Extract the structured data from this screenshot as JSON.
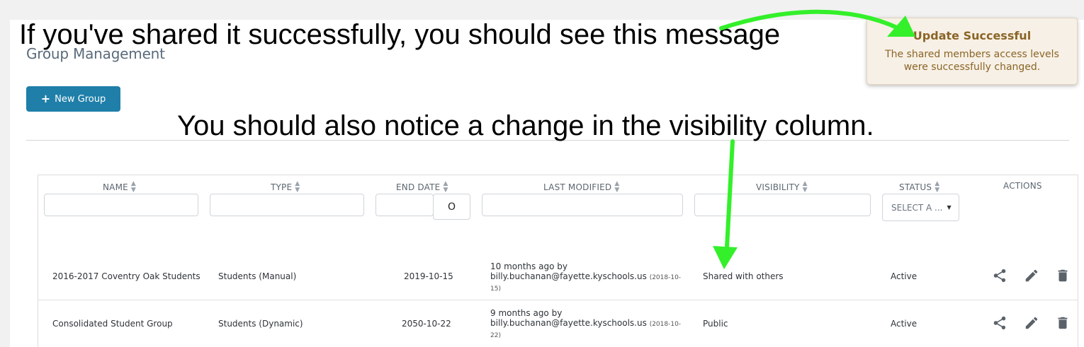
{
  "annotations": {
    "top_caption": "If you've shared it successfully, you should see this message",
    "mid_caption": "You should also notice a change in the visibility column.",
    "arrow_color": "#33f02a"
  },
  "page": {
    "title": "Group Management",
    "new_group_label": "New Group"
  },
  "toast": {
    "title": "Update Successful",
    "message": "The shared members access levels were successfully changed."
  },
  "table": {
    "headers": {
      "name": "NAME",
      "type": "TYPE",
      "end_date": "END DATE",
      "last_modified": "LAST MODIFIED",
      "visibility": "VISIBILITY",
      "status": "STATUS",
      "actions": "ACTIONS"
    },
    "status_select": "SELECT A ...",
    "date_button": "O",
    "rows": [
      {
        "name": "2016-2017 Coventry Oak Students",
        "type": "Students (Manual)",
        "end_date": "2019-10-15",
        "modified_ago": "10 months ago by",
        "modified_by": "billy.buchanan@fayette.kyschools.us",
        "modified_date": "(2018-10-15)",
        "visibility": "Shared with others",
        "status": "Active"
      },
      {
        "name": "Consolidated Student Group",
        "type": "Students (Dynamic)",
        "end_date": "2050-10-22",
        "modified_ago": "9 months ago by",
        "modified_by": "billy.buchanan@fayette.kyschools.us",
        "modified_date": "(2018-10-22)",
        "visibility": "Public",
        "status": "Active"
      }
    ]
  },
  "colors": {
    "primary_button": "#1f7fa9",
    "toast_text": "#8a6526",
    "toast_bg": "#f7f0e6"
  }
}
